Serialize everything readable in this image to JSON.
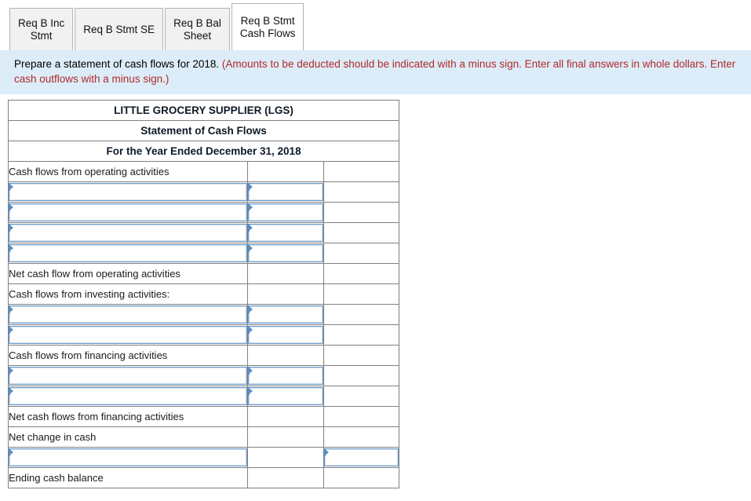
{
  "tabs": [
    {
      "label": "Req B Inc\nStmt",
      "active": false
    },
    {
      "label": "Req B Stmt SE",
      "active": false
    },
    {
      "label": "Req B Bal\nSheet",
      "active": false
    },
    {
      "label": "Req B Stmt\nCash Flows",
      "active": true
    }
  ],
  "instruction": {
    "main": "Prepare a statement of cash flows for 2018. ",
    "note": "(Amounts to be deducted should be indicated with a minus sign. Enter all final answers in whole dollars. Enter cash outflows with a minus sign.)"
  },
  "statement": {
    "header": [
      "LITTLE GROCERY SUPPLIER (LGS)",
      "Statement of Cash Flows",
      "For the Year Ended December 31, 2018"
    ],
    "rows": [
      {
        "kind": "label",
        "label": "Cash flows from operating activities",
        "value": "",
        "right": ""
      },
      {
        "kind": "input",
        "label": "",
        "value": "",
        "right": ""
      },
      {
        "kind": "input",
        "label": "",
        "value": "",
        "right": ""
      },
      {
        "kind": "input",
        "label": "",
        "value": "",
        "right": ""
      },
      {
        "kind": "input",
        "label": "",
        "value": "",
        "right": "",
        "mid_bottom_rule": true
      },
      {
        "kind": "label",
        "label": "Net cash flow from operating activities",
        "value": "",
        "right": ""
      },
      {
        "kind": "label",
        "label": "Cash flows from investing activities:",
        "value": "",
        "right": ""
      },
      {
        "kind": "input",
        "label": "",
        "value": "",
        "right": ""
      },
      {
        "kind": "input",
        "label": "",
        "value": "",
        "right": "",
        "mid_bottom_rule": true
      },
      {
        "kind": "label",
        "label": "Cash flows from financing activities",
        "value": "",
        "right": ""
      },
      {
        "kind": "input",
        "label": "",
        "value": "",
        "right": ""
      },
      {
        "kind": "input",
        "label": "",
        "value": "",
        "right": "",
        "mid_bottom_rule": true
      },
      {
        "kind": "label",
        "label": "Net cash flows from financing activities",
        "value": "",
        "right": ""
      },
      {
        "kind": "label",
        "label": "Net change in cash",
        "value": "",
        "right": "",
        "right_bottom_rule": true
      },
      {
        "kind": "input-right",
        "label": "",
        "value": "",
        "right": ""
      },
      {
        "kind": "label",
        "label": "Ending cash balance",
        "value": "",
        "right": "",
        "right_bottom_rule": true
      }
    ]
  },
  "colors": {
    "header_blue": "#74a9dc",
    "panel_blue": "#dcecf8",
    "note_red": "#b02a2a",
    "field_border": "#6f9bc8",
    "marker_blue": "#5a8ec4"
  },
  "icons": {
    "dropdown_marker": "triangle-right-marker-icon"
  }
}
